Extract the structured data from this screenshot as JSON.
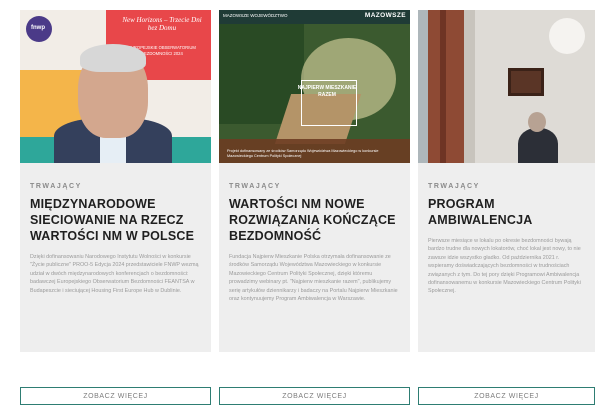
{
  "cards": [
    {
      "status": "TRWAJĄCY",
      "title": "MIĘDZYNARODOWE SIECIOWANIE NA RZECZ WARTOŚCI NM W POLSCE",
      "description": "Dzięki dofinansowaniu Narodowego Instytutu Wolności w konkursie \"Życie publiczne\" PROO-5 Edycja 2024 przedstawiciele FNWP wezmą udział w dwóch międzynarodowych konferencjach o bezdomności: badawczej Europejskiego Obserwatorium Bezdomności FEANTSA w Budapeszcie i sieciującej Housing First Europe Hub w Dublinie.",
      "image": {
        "logo": "fnwp",
        "headline": "New Horizons – Trzecie Dni bez Domu",
        "subtext": "EUROPEJSKIE OBSERWATORIUM BEZDOMNOŚCI 2024"
      },
      "button": "ZOBACZ WIĘCEJ"
    },
    {
      "status": "TRWAJĄCY",
      "title": "WARTOŚCI NM NOWE ROZWIĄZANIA KOŃCZĄCE BEZDOMNOŚĆ",
      "description": "Fundacja Najpierw Mieszkanie Polska otrzymała dofinansowanie ze środków Samorządu Województwa Mazowieckiego w konkursie Mazowieckiego Centrum Polityki Społecznej, dzięki któremu prowadzimy webinary pt. \"Najpierw mieszkanie razem\", publikujemy serię artykułów dziennikarzy i badaczy na Portalu Najpierw Mieszkanie oraz kontynuujemy Program Ambiwalencja w Warszawie.",
      "image": {
        "topbar_left": "MAZOWSZE WOJEWÓDZTWO",
        "topbar_right": "MAZOWSZE",
        "box_text": "NAJPIERW MIESZKANIE RAZEM",
        "caption": "Projekt dofinansowany ze środków Samorządu Województwa Mazowieckiego w konkursie Mazowieckiego Centrum Polityki Społecznej"
      },
      "button": "ZOBACZ WIĘCEJ"
    },
    {
      "status": "TRWAJĄCY",
      "title": "PROGRAM AMBIWALENCJA",
      "description": "Pierwsze miesiące w lokalu po okresie bezdomności bywają bardzo trudne dla nowych lokatorów, choć lokal jest nowy, to nie zawsze idzie wszystko gładko. Od października 2021 r. wspieramy doświadczających bezdomności w trudnościach związanych z tym. Do tej pory dzięki Programowi Ambiwalencja dofinansowanemu w konkursie Mazowieckiego Centrum Polityki Społecznej.",
      "button": "ZOBACZ WIĘCEJ"
    }
  ],
  "colors": {
    "card_bg": "#eeeeee",
    "button_border": "#2e7d73",
    "status_text": "#8a8a8a",
    "title_text": "#1f1f1f"
  }
}
